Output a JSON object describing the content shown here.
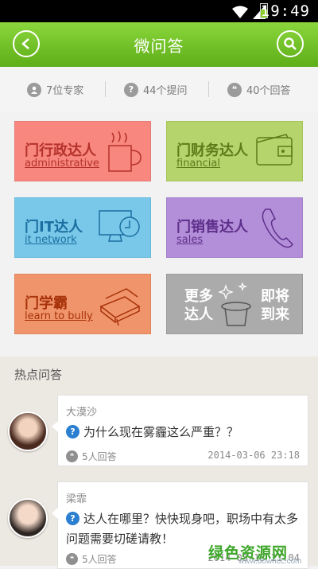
{
  "status_bar": {
    "time": "19:49"
  },
  "header": {
    "title": "微问答"
  },
  "stats": [
    {
      "label": "7位专家",
      "icon": "person-icon"
    },
    {
      "label": "44个提问",
      "icon": "question-icon"
    },
    {
      "label": "40个回答",
      "icon": "quote-icon"
    }
  ],
  "categories": [
    {
      "cn": "门行政达人",
      "en": "administrative",
      "icon": "coffee-cup-icon",
      "color": "#f7877f"
    },
    {
      "cn": "门财务达人",
      "en": "financial",
      "icon": "wallet-icon",
      "color": "#b5d46b"
    },
    {
      "cn": "门IT达人",
      "en": "it network",
      "icon": "monitor-icon",
      "color": "#79c8ea"
    },
    {
      "cn": "门销售达人",
      "en": "sales",
      "icon": "phone-icon",
      "color": "#b48fd9"
    },
    {
      "cn": "门学霸",
      "en": "learn to bully",
      "icon": "books-icon",
      "color": "#f0946b"
    }
  ],
  "more_tile": {
    "left": "更多\n达人",
    "right": "即将\n到来",
    "icon": "magic-hat-icon"
  },
  "hot_section": {
    "title": "热点问答"
  },
  "questions": [
    {
      "user": "大漠沙",
      "question": "为什么现在雾霾这么严重？？",
      "answers": "5人回答",
      "date": "2014-03-06 23:18"
    },
    {
      "user": "梁霏",
      "question": "达人在哪里？快快现身吧，职场中有太多问题需要切磋请教！",
      "answers": "5人回答",
      "date": "2014-03-13 21:04"
    }
  ],
  "watermark": {
    "big": "绿色资源网",
    "small": "www.downcc.com"
  },
  "colors": {
    "header_green": "#6cc024",
    "question_blue": "#2a7fd0"
  }
}
